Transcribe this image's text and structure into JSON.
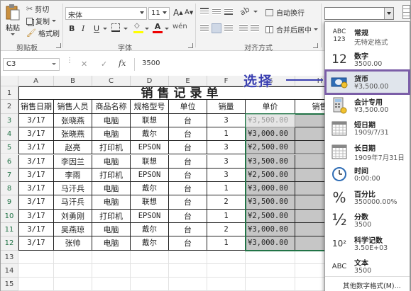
{
  "ribbon": {
    "paste_label": "粘贴",
    "cut_label": "剪切",
    "copy_label": "复制",
    "format_painter_label": "格式刷",
    "clipboard_group": "剪贴板",
    "font_name": "宋体",
    "font_size": "11",
    "font_group": "字体",
    "bold": "B",
    "italic": "I",
    "underline": "U",
    "font_color_letter": "A",
    "grow_font": "A",
    "shrink_font": "A",
    "wrap_text_label": "自动换行",
    "merge_center_label": "合并后居中",
    "alignment_group": "对齐方式",
    "number_format_value": ""
  },
  "formula_bar": {
    "name_box": "C3",
    "fx": "fx",
    "cancel": "✕",
    "enter": "✓",
    "value": "3500"
  },
  "sheet": {
    "columns": [
      "A",
      "B",
      "C",
      "D",
      "E",
      "F",
      "G",
      "H"
    ],
    "rows": [
      "1",
      "2",
      "3",
      "4",
      "5",
      "6",
      "7",
      "8",
      "9",
      "10",
      "11",
      "12",
      "13",
      "14",
      "15"
    ],
    "title": "销售记录单",
    "headers": [
      "销售日期",
      "销售人员",
      "商品名称",
      "规格型号",
      "单位",
      "销量",
      "单价",
      "销售"
    ],
    "data": [
      [
        "3/17",
        "张晓燕",
        "电脑",
        "联想",
        "台",
        "3",
        "¥3,500.00"
      ],
      [
        "3/17",
        "张晓燕",
        "电脑",
        "戴尔",
        "台",
        "1",
        "¥3,000.00"
      ],
      [
        "3/17",
        "赵亮",
        "打印机",
        "EPSON",
        "台",
        "3",
        "¥2,500.00"
      ],
      [
        "3/17",
        "李因兰",
        "电脑",
        "联想",
        "台",
        "3",
        "¥3,500.00"
      ],
      [
        "3/17",
        "李雨",
        "打印机",
        "EPSON",
        "台",
        "3",
        "¥2,500.00"
      ],
      [
        "3/17",
        "马汗兵",
        "电脑",
        "戴尔",
        "台",
        "1",
        "¥3,000.00"
      ],
      [
        "3/17",
        "马汗兵",
        "电脑",
        "联想",
        "台",
        "2",
        "¥3,500.00"
      ],
      [
        "3/17",
        "刘勇刚",
        "打印机",
        "EPSON",
        "台",
        "1",
        "¥2,500.00"
      ],
      [
        "3/17",
        "吴燕琼",
        "电脑",
        "戴尔",
        "台",
        "2",
        "¥3,000.00"
      ],
      [
        "3/17",
        "张帅",
        "电脑",
        "戴尔",
        "台",
        "1",
        "¥3,000.00"
      ]
    ]
  },
  "annotation": {
    "text": "选择",
    "color": "#3a3fb0"
  },
  "number_format_menu": {
    "items": [
      {
        "icon": "general-icon",
        "glyph": "ABC\n123",
        "name": "常规",
        "sample": "无特定格式"
      },
      {
        "icon": "number-icon",
        "glyph": "12",
        "name": "数字",
        "sample": "3500.00"
      },
      {
        "icon": "currency-icon",
        "glyph": "",
        "name": "货币",
        "sample": "¥3,500.00"
      },
      {
        "icon": "accounting-icon",
        "glyph": "",
        "name": "会计专用",
        "sample": "¥3,500.00"
      },
      {
        "icon": "short-date-icon",
        "glyph": "",
        "name": "短日期",
        "sample": "1909/7/31"
      },
      {
        "icon": "long-date-icon",
        "glyph": "",
        "name": "长日期",
        "sample": "1909年7月31日"
      },
      {
        "icon": "time-icon",
        "glyph": "",
        "name": "时间",
        "sample": "0:00:00"
      },
      {
        "icon": "percent-icon",
        "glyph": "%",
        "name": "百分比",
        "sample": "350000.00%"
      },
      {
        "icon": "fraction-icon",
        "glyph": "½",
        "name": "分数",
        "sample": "3500"
      },
      {
        "icon": "scientific-icon",
        "glyph": "10²",
        "name": "科学记数",
        "sample": "3.50E+03"
      },
      {
        "icon": "text-icon",
        "glyph": "ABC",
        "name": "文本",
        "sample": "3500"
      }
    ],
    "more_label": "其他数字格式(M)..."
  },
  "colors": {
    "accent": "#217346",
    "highlight_border": "#7b5ea7",
    "selection_fill": "#c6c6c6",
    "annotation": "#3a3fb0"
  }
}
